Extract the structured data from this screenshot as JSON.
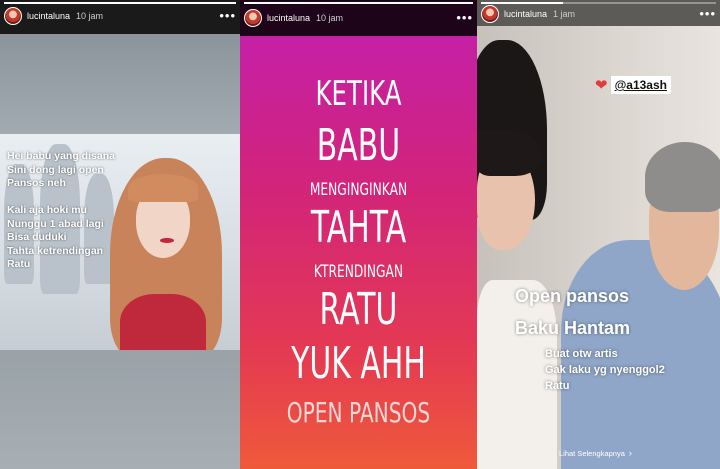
{
  "stories": [
    {
      "username": "lucintaluna",
      "time": "10 jam",
      "more_icon": "more-dots-icon",
      "progress": 1.0,
      "caption_lines_1": [
        "Hei babu yang disana",
        "Sini dong lagi open",
        "Pansos neh"
      ],
      "caption_lines_2": [
        "Kali aja hoki mu",
        "Nunggu 1 abad lagi",
        "Bisa duduki",
        "Tahta ketrendingan",
        "Ratu"
      ]
    },
    {
      "username": "lucintaluna",
      "time": "10 jam",
      "more_icon": "more-dots-icon",
      "progress": 1.0,
      "lines": [
        "KETIKA",
        "BABU",
        "MENGINGINKAN",
        "TAHTA",
        "KTRENDINGAN",
        "RATU",
        "YUK AHH",
        "OPEN PANSOS"
      ],
      "background_gradient": [
        "#c21fb0",
        "#ef5a3a"
      ]
    },
    {
      "username": "lucintaluna",
      "time": "1 jam",
      "more_icon": "more-dots-icon",
      "progress": 0.35,
      "mention": "@a13ash",
      "mention_icon": "heart-icon",
      "title_1": "Open pansos",
      "title_2": "Baku Hantam",
      "sub_lines": [
        "Buat otw artis",
        "Gak laku yg nyenggol2",
        "Ratu"
      ],
      "see_more": "Lihat Selengkapnya"
    }
  ]
}
